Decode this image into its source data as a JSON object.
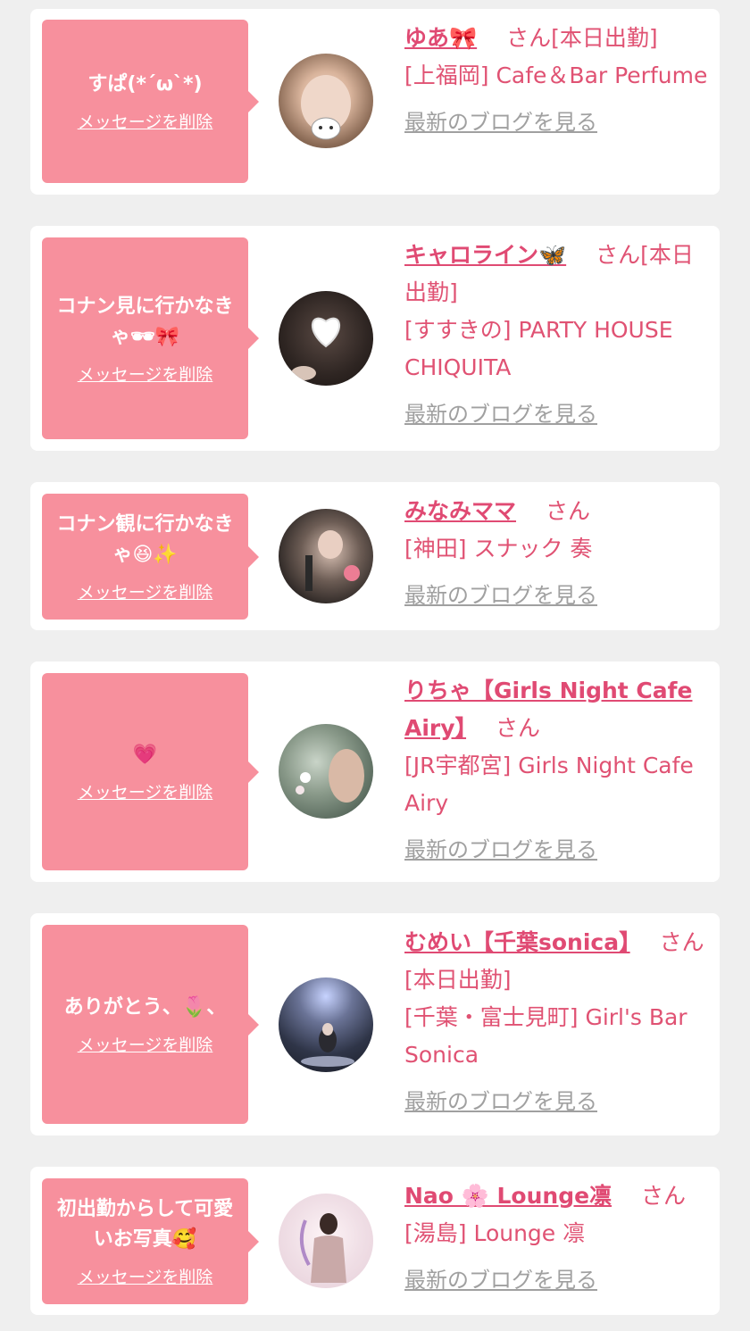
{
  "colors": {
    "page_background": "#efefef",
    "card_background": "#ffffff",
    "bubble": "#f7909d",
    "name": "#e04a73",
    "text_pink": "#e05273",
    "blog_link": "#a0a0a0"
  },
  "items": [
    {
      "message": "すぱ(*´ω`*)",
      "delete_label": "メッセージを削除",
      "name": "ゆあ🎀",
      "honorific": "さん",
      "status": "[本日出勤]",
      "shop": "[上福岡] Cafe＆Bar Perfume",
      "blog_label": "最新のブログを見る",
      "avatar_icon": "avatar-photo"
    },
    {
      "message": "コナン見に行かなきゃ🕶🎀",
      "delete_label": "メッセージを削除",
      "name": "キャロライン🦋",
      "honorific": "さん",
      "status": "[本日出勤]",
      "shop": "[すすきの] PARTY HOUSE CHIQUITA",
      "blog_label": "最新のブログを見る",
      "avatar_icon": "avatar-photo"
    },
    {
      "message": "コナン観に行かなきゃ😆✨",
      "delete_label": "メッセージを削除",
      "name": "みなみママ",
      "honorific": "さん",
      "status": "",
      "shop": "[神田] スナック 奏",
      "blog_label": "最新のブログを見る",
      "avatar_icon": "avatar-photo"
    },
    {
      "message": "💗",
      "delete_label": "メッセージを削除",
      "name": "りちゃ【Girls Night Cafe Airy】",
      "honorific": "さん",
      "status": "",
      "shop": "[JR宇都宮] Girls Night Cafe Airy",
      "blog_label": "最新のブログを見る",
      "avatar_icon": "avatar-photo"
    },
    {
      "message": "ありがとう、🌷、",
      "delete_label": "メッセージを削除",
      "name": "むめい【千葉sonica】",
      "honorific": "さん",
      "status": "[本日出勤]",
      "shop": "[千葉・富士見町] Girl's Bar Sonica",
      "blog_label": "最新のブログを見る",
      "avatar_icon": "avatar-photo"
    },
    {
      "message": "初出勤からして可愛いお写真🥰",
      "delete_label": "メッセージを削除",
      "name": "Nao 🌸 Lounge凛",
      "honorific": "さん",
      "status": "",
      "shop": "[湯島] Lounge 凛",
      "blog_label": "最新のブログを見る",
      "avatar_icon": "avatar-photo"
    }
  ]
}
